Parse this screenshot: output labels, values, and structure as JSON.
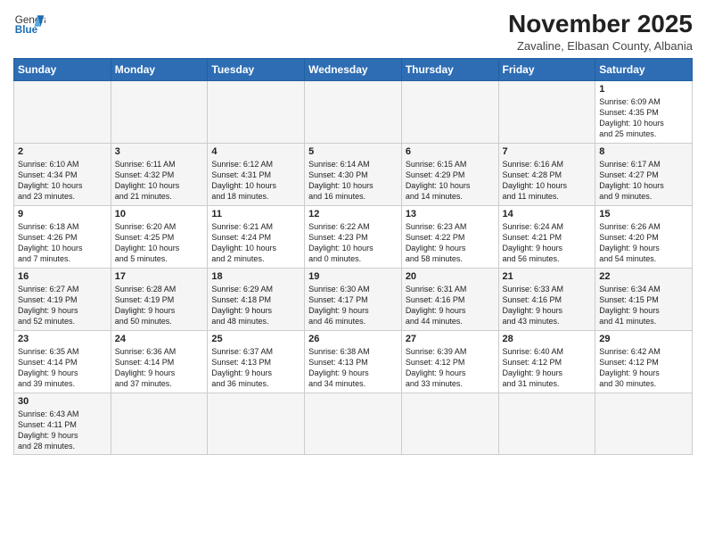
{
  "header": {
    "logo_general": "General",
    "logo_blue": "Blue",
    "month": "November 2025",
    "location": "Zavaline, Elbasan County, Albania"
  },
  "weekdays": [
    "Sunday",
    "Monday",
    "Tuesday",
    "Wednesday",
    "Thursday",
    "Friday",
    "Saturday"
  ],
  "weeks": [
    [
      {
        "day": "",
        "info": ""
      },
      {
        "day": "",
        "info": ""
      },
      {
        "day": "",
        "info": ""
      },
      {
        "day": "",
        "info": ""
      },
      {
        "day": "",
        "info": ""
      },
      {
        "day": "",
        "info": ""
      },
      {
        "day": "1",
        "info": "Sunrise: 6:09 AM\nSunset: 4:35 PM\nDaylight: 10 hours\nand 25 minutes."
      }
    ],
    [
      {
        "day": "2",
        "info": "Sunrise: 6:10 AM\nSunset: 4:34 PM\nDaylight: 10 hours\nand 23 minutes."
      },
      {
        "day": "3",
        "info": "Sunrise: 6:11 AM\nSunset: 4:32 PM\nDaylight: 10 hours\nand 21 minutes."
      },
      {
        "day": "4",
        "info": "Sunrise: 6:12 AM\nSunset: 4:31 PM\nDaylight: 10 hours\nand 18 minutes."
      },
      {
        "day": "5",
        "info": "Sunrise: 6:14 AM\nSunset: 4:30 PM\nDaylight: 10 hours\nand 16 minutes."
      },
      {
        "day": "6",
        "info": "Sunrise: 6:15 AM\nSunset: 4:29 PM\nDaylight: 10 hours\nand 14 minutes."
      },
      {
        "day": "7",
        "info": "Sunrise: 6:16 AM\nSunset: 4:28 PM\nDaylight: 10 hours\nand 11 minutes."
      },
      {
        "day": "8",
        "info": "Sunrise: 6:17 AM\nSunset: 4:27 PM\nDaylight: 10 hours\nand 9 minutes."
      }
    ],
    [
      {
        "day": "9",
        "info": "Sunrise: 6:18 AM\nSunset: 4:26 PM\nDaylight: 10 hours\nand 7 minutes."
      },
      {
        "day": "10",
        "info": "Sunrise: 6:20 AM\nSunset: 4:25 PM\nDaylight: 10 hours\nand 5 minutes."
      },
      {
        "day": "11",
        "info": "Sunrise: 6:21 AM\nSunset: 4:24 PM\nDaylight: 10 hours\nand 2 minutes."
      },
      {
        "day": "12",
        "info": "Sunrise: 6:22 AM\nSunset: 4:23 PM\nDaylight: 10 hours\nand 0 minutes."
      },
      {
        "day": "13",
        "info": "Sunrise: 6:23 AM\nSunset: 4:22 PM\nDaylight: 9 hours\nand 58 minutes."
      },
      {
        "day": "14",
        "info": "Sunrise: 6:24 AM\nSunset: 4:21 PM\nDaylight: 9 hours\nand 56 minutes."
      },
      {
        "day": "15",
        "info": "Sunrise: 6:26 AM\nSunset: 4:20 PM\nDaylight: 9 hours\nand 54 minutes."
      }
    ],
    [
      {
        "day": "16",
        "info": "Sunrise: 6:27 AM\nSunset: 4:19 PM\nDaylight: 9 hours\nand 52 minutes."
      },
      {
        "day": "17",
        "info": "Sunrise: 6:28 AM\nSunset: 4:19 PM\nDaylight: 9 hours\nand 50 minutes."
      },
      {
        "day": "18",
        "info": "Sunrise: 6:29 AM\nSunset: 4:18 PM\nDaylight: 9 hours\nand 48 minutes."
      },
      {
        "day": "19",
        "info": "Sunrise: 6:30 AM\nSunset: 4:17 PM\nDaylight: 9 hours\nand 46 minutes."
      },
      {
        "day": "20",
        "info": "Sunrise: 6:31 AM\nSunset: 4:16 PM\nDaylight: 9 hours\nand 44 minutes."
      },
      {
        "day": "21",
        "info": "Sunrise: 6:33 AM\nSunset: 4:16 PM\nDaylight: 9 hours\nand 43 minutes."
      },
      {
        "day": "22",
        "info": "Sunrise: 6:34 AM\nSunset: 4:15 PM\nDaylight: 9 hours\nand 41 minutes."
      }
    ],
    [
      {
        "day": "23",
        "info": "Sunrise: 6:35 AM\nSunset: 4:14 PM\nDaylight: 9 hours\nand 39 minutes."
      },
      {
        "day": "24",
        "info": "Sunrise: 6:36 AM\nSunset: 4:14 PM\nDaylight: 9 hours\nand 37 minutes."
      },
      {
        "day": "25",
        "info": "Sunrise: 6:37 AM\nSunset: 4:13 PM\nDaylight: 9 hours\nand 36 minutes."
      },
      {
        "day": "26",
        "info": "Sunrise: 6:38 AM\nSunset: 4:13 PM\nDaylight: 9 hours\nand 34 minutes."
      },
      {
        "day": "27",
        "info": "Sunrise: 6:39 AM\nSunset: 4:12 PM\nDaylight: 9 hours\nand 33 minutes."
      },
      {
        "day": "28",
        "info": "Sunrise: 6:40 AM\nSunset: 4:12 PM\nDaylight: 9 hours\nand 31 minutes."
      },
      {
        "day": "29",
        "info": "Sunrise: 6:42 AM\nSunset: 4:12 PM\nDaylight: 9 hours\nand 30 minutes."
      }
    ],
    [
      {
        "day": "30",
        "info": "Sunrise: 6:43 AM\nSunset: 4:11 PM\nDaylight: 9 hours\nand 28 minutes."
      },
      {
        "day": "",
        "info": ""
      },
      {
        "day": "",
        "info": ""
      },
      {
        "day": "",
        "info": ""
      },
      {
        "day": "",
        "info": ""
      },
      {
        "day": "",
        "info": ""
      },
      {
        "day": "",
        "info": ""
      }
    ]
  ]
}
